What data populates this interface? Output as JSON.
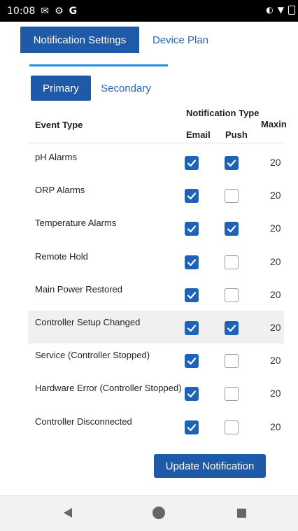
{
  "status_bar": {
    "time": "10:08",
    "g_label": "G"
  },
  "tabs": [
    {
      "label": "Notification Settings",
      "active": true
    },
    {
      "label": "Device Plan",
      "active": false
    }
  ],
  "subtabs": [
    {
      "label": "Primary",
      "active": true
    },
    {
      "label": "Secondary",
      "active": false
    }
  ],
  "table": {
    "event_type_header": "Event Type",
    "notification_type_header": "Notification Type",
    "email_header": "Email",
    "push_header": "Push",
    "max_header": "Maxin",
    "rows": [
      {
        "event": "pH Alarms",
        "email": true,
        "push": true,
        "max": "20"
      },
      {
        "event": "ORP Alarms",
        "email": true,
        "push": false,
        "max": "20"
      },
      {
        "event": "Temperature Alarms",
        "email": true,
        "push": true,
        "max": "20"
      },
      {
        "event": "Remote Hold",
        "email": true,
        "push": false,
        "max": "20"
      },
      {
        "event": "Main Power Restored",
        "email": true,
        "push": false,
        "max": "20"
      },
      {
        "event": "Controller Setup Changed",
        "email": true,
        "push": true,
        "max": "20"
      },
      {
        "event": "Service (Controller Stopped)",
        "email": true,
        "push": false,
        "max": "20"
      },
      {
        "event": "Hardware Error (Controller Stopped)",
        "email": true,
        "push": false,
        "max": "20"
      },
      {
        "event": "Controller Disconnected",
        "email": true,
        "push": false,
        "max": "20"
      }
    ]
  },
  "update_button_label": "Update Notification",
  "colors": {
    "primary": "#1f5aa8",
    "link": "#2a66b8",
    "underline": "#1f8fe0",
    "checkbox": "#1d63b8"
  }
}
